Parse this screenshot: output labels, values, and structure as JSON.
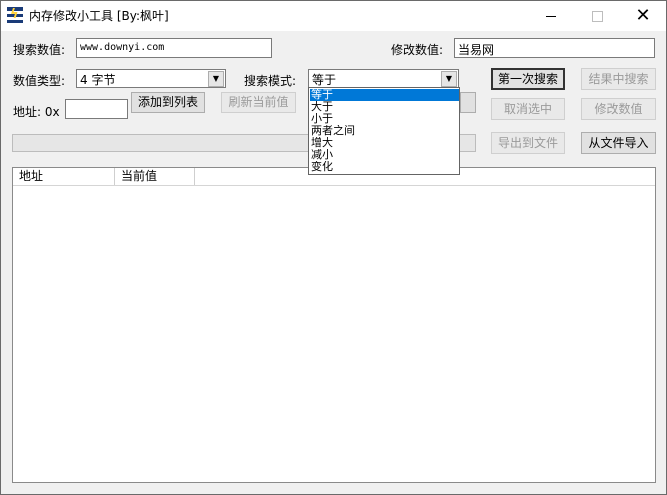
{
  "window": {
    "title": "内存修改小工具 [By:枫叶]",
    "icon": "lightning-app-icon",
    "controls": {
      "minimize": "minimize-icon",
      "maximize": "maximize-icon",
      "close": "✕"
    }
  },
  "search_value": {
    "label": "搜索数值:",
    "value": "www.downyi.com"
  },
  "modify_value": {
    "label": "修改数值:",
    "value": "当易网"
  },
  "value_type": {
    "label": "数值类型:",
    "selected": "4 字节"
  },
  "search_mode": {
    "label": "搜索模式:",
    "selected": "等于",
    "options": [
      "等于",
      "大于",
      "小于",
      "两者之间",
      "增大",
      "减小",
      "变化"
    ],
    "highlighted_index": 0
  },
  "address": {
    "label": "地址: 0x",
    "value": ""
  },
  "buttons": {
    "first_search": "第一次搜索",
    "search_in_results": "结果中搜索",
    "add_to_list": "添加到列表",
    "refresh_current": "刷新当前值",
    "cancel_selection": "取消选中",
    "modify": "修改数值",
    "export_file": "导出到文件",
    "import_file": "从文件导入"
  },
  "list": {
    "columns": [
      "地址",
      "当前值"
    ],
    "rows": []
  },
  "colors": {
    "accent": "#0078d7",
    "disabled_text": "#9a9a9a"
  }
}
